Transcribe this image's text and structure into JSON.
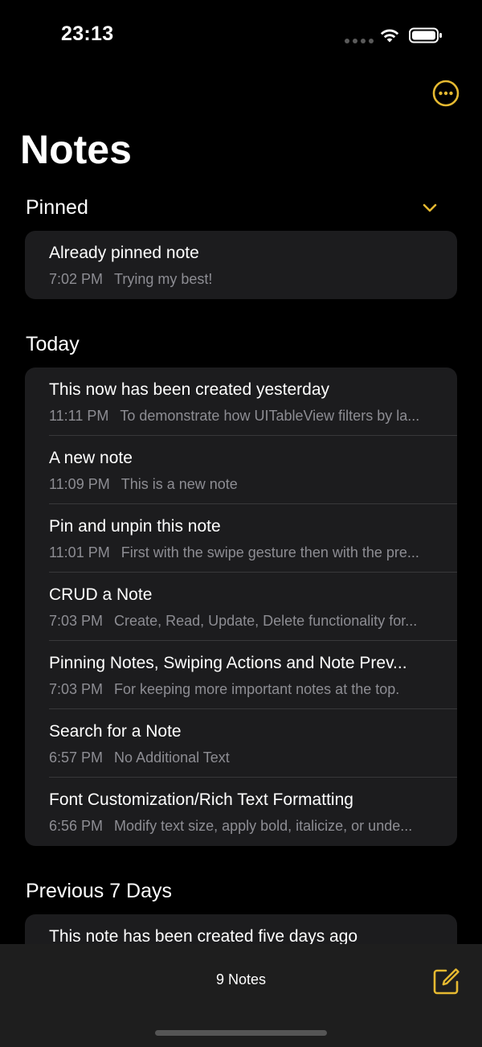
{
  "status_bar": {
    "time": "23:13"
  },
  "header": {
    "title": "Notes",
    "more_icon": "ellipsis-circle-icon"
  },
  "accent_color": "#e5b931",
  "sections": {
    "pinned": {
      "header": "Pinned",
      "toggle_icon": "chevron-down-icon",
      "notes": [
        {
          "title": "Already pinned note",
          "time": "7:02 PM",
          "preview": "Trying my best!"
        }
      ]
    },
    "today": {
      "header": "Today",
      "notes": [
        {
          "title": "This now has been created yesterday",
          "time": "11:11 PM",
          "preview": "To demonstrate how UITableView filters by la..."
        },
        {
          "title": "A new note",
          "time": "11:09 PM",
          "preview": "This is a new note"
        },
        {
          "title": "Pin and unpin this note",
          "time": "11:01 PM",
          "preview": "First with the swipe gesture then with the pre..."
        },
        {
          "title": "CRUD a Note",
          "time": "7:03 PM",
          "preview": "Create, Read, Update, Delete functionality for..."
        },
        {
          "title": "Pinning Notes, Swiping Actions and Note Prev...",
          "time": "7:03 PM",
          "preview": "For keeping more important notes at the top."
        },
        {
          "title": "Search for a Note",
          "time": "6:57 PM",
          "preview": "No Additional Text"
        },
        {
          "title": "Font Customization/Rich Text Formatting",
          "time": "6:56 PM",
          "preview": "Modify text size, apply bold, italicize, or unde..."
        }
      ]
    },
    "previous_7_days": {
      "header": "Previous 7 Days",
      "notes": [
        {
          "title": "This note has been created five days ago"
        }
      ]
    }
  },
  "toolbar": {
    "notes_count": "9 Notes",
    "compose_icon": "compose-icon"
  }
}
